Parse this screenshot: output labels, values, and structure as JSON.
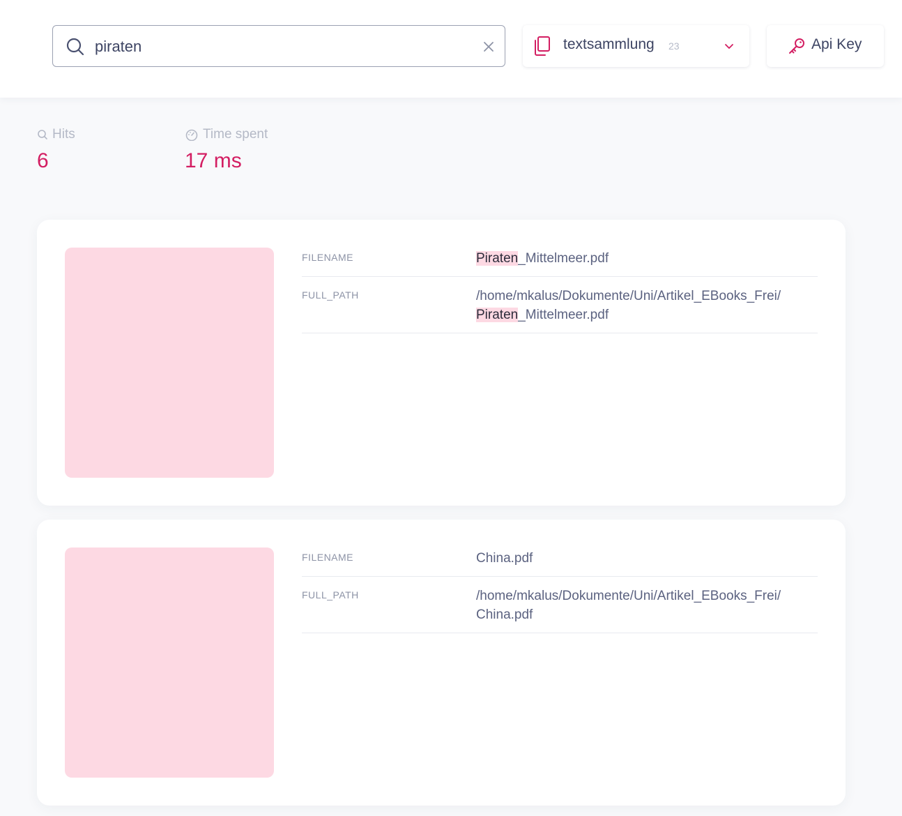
{
  "search": {
    "value": "piraten",
    "clear_icon": "close-icon",
    "icon": "search-icon"
  },
  "index_select": {
    "name": "textsammlung",
    "count": "23",
    "icon": "documents-icon"
  },
  "api_button": {
    "label": "Api Key",
    "icon": "key-icon"
  },
  "stats": {
    "hits_label": "Hits",
    "hits_value": "6",
    "time_label": "Time spent",
    "time_value": "17 ms"
  },
  "results": [
    {
      "filename_key": "FILENAME",
      "filename_highlight": "Piraten",
      "filename_rest": "_Mittelmeer.pdf",
      "full_path_key": "FULL_PATH",
      "full_path_line1": "/home/mkalus/Dokumente/Uni/Artikel_EBooks_Frei/",
      "full_path_highlight": "Piraten",
      "full_path_rest": "_Mittelmeer.pdf"
    },
    {
      "filename_key": "FILENAME",
      "filename": "China.pdf",
      "full_path_key": "FULL_PATH",
      "full_path_line1": "/home/mkalus/Dokumente/Uni/Artikel_EBooks_Frei/",
      "full_path_line2": "China.pdf"
    }
  ],
  "colors": {
    "accent": "#d31e62",
    "thumbnail": "#fdd9e3",
    "text": "#4a5170"
  }
}
